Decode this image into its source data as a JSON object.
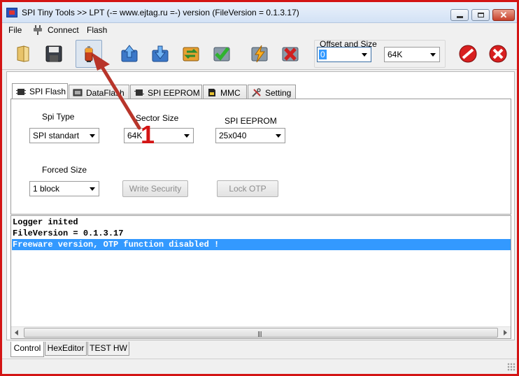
{
  "window": {
    "title": "SPI Tiny Tools >> LPT (-= www.ejtag.ru =-) version (FileVersion = 0.1.3.17)"
  },
  "menu": {
    "file": "File",
    "connect": "Connect",
    "flash": "Flash"
  },
  "toolbar": {
    "buttons": [
      {
        "name": "open-file-icon"
      },
      {
        "name": "save-icon"
      },
      {
        "name": "chip-detect-icon",
        "pressed": true
      },
      {
        "name": "upload-arrow-icon"
      },
      {
        "name": "download-arrow-icon"
      },
      {
        "name": "verify-cycle-icon"
      },
      {
        "name": "check-icon"
      },
      {
        "name": "lightning-icon"
      },
      {
        "name": "erase-x-icon"
      },
      {
        "name": "stop-icon"
      },
      {
        "name": "exit-icon"
      }
    ],
    "offset_size_label": "Offset and Size",
    "offset_value": "0",
    "size_value": "64K"
  },
  "tabs": {
    "items": [
      {
        "label": "SPI Flash",
        "icon": "chip-icon",
        "active": true
      },
      {
        "label": "DataFlash",
        "icon": "dataflash-icon",
        "active": false
      },
      {
        "label": "SPI EEPROM",
        "icon": "eeprom-icon",
        "active": false
      },
      {
        "label": "MMC",
        "icon": "mmc-card-icon",
        "active": false
      },
      {
        "label": "Setting",
        "icon": "tools-icon",
        "active": false
      }
    ]
  },
  "spi_flash": {
    "spi_type_label": "Spi Type",
    "spi_type_value": "SPI standart",
    "sector_size_label": "Sector Size",
    "sector_size_value": "64K",
    "spi_eeprom_label": "SPI EEPROM",
    "spi_eeprom_value": "25x040",
    "forced_size_label": "Forced Size",
    "forced_size_value": "1 block",
    "write_security_label": "Write Security",
    "lock_otp_label": "Lock OTP"
  },
  "log": {
    "lines": [
      "Logger inited",
      "FileVersion = 0.1.3.17",
      "Freeware version, OTP function disabled !"
    ],
    "selected_index": 2
  },
  "bottom_tabs": {
    "items": [
      {
        "label": "Control",
        "active": true
      },
      {
        "label": "HexEditor",
        "active": false
      },
      {
        "label": "TEST HW",
        "active": false
      }
    ]
  },
  "annotation": {
    "number": "1",
    "color": "#d31414"
  }
}
